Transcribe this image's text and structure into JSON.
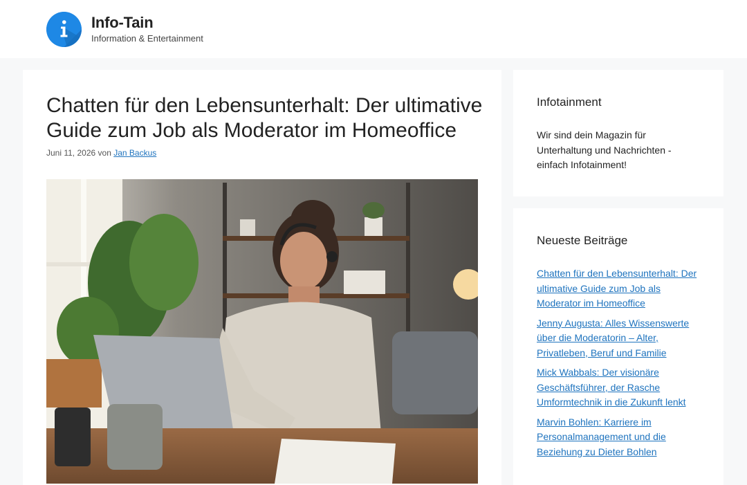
{
  "site": {
    "title": "Info-Tain",
    "tagline": "Information & Entertainment",
    "logo_icon": "info-icon",
    "accent": "#1e88e5",
    "link_color": "#1e73be"
  },
  "article": {
    "title": "Chatten für den Lebensunterhalt: Der ultimative Guide zum Job als Moderator im Homeoffice",
    "date": "Juni 11, 2026",
    "by": "von",
    "author": "Jan Backus",
    "image_alt": "Frau mit Headset am Laptop im Homeoffice"
  },
  "sidebar": {
    "about": {
      "title": "Infotainment",
      "text": "Wir sind dein Magazin für Unterhaltung und Nachrichten - einfach Infotainment!"
    },
    "recent": {
      "title": "Neueste Beiträge",
      "posts": [
        "Chatten für den Lebensunterhalt: Der ultimative Guide zum Job als Moderator im Homeoffice",
        "Jenny Augusta: Alles Wissenswerte über die Moderatorin – Alter, Privatleben, Beruf und Familie",
        "Mick Wabbals: Der visionäre Geschäftsführer, der Rasche Umformtechnik in die Zukunft lenkt",
        "Marvin Bohlen: Karriere im Personalmanagement und die Beziehung zu Dieter Bohlen"
      ]
    }
  }
}
